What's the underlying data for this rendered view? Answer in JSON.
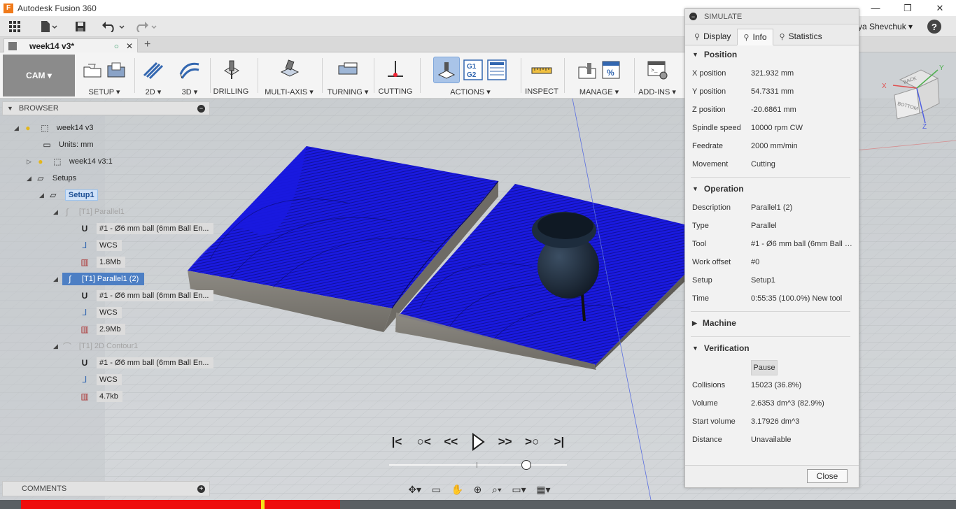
{
  "window": {
    "title": "Autodesk Fusion 360",
    "controls": [
      "—",
      "❐",
      "✕"
    ]
  },
  "qat": {
    "user": "ya Shevchuk ▾",
    "help": "?"
  },
  "document_tab": {
    "name": "week14 v3*"
  },
  "toolbar": {
    "workspace": "CAM ▾",
    "groups": [
      {
        "label": "SETUP ▾"
      },
      {
        "label": "2D ▾"
      },
      {
        "label": "3D ▾"
      },
      {
        "label": "DRILLING"
      },
      {
        "label": "MULTI-AXIS ▾"
      },
      {
        "label": "TURNING ▾"
      },
      {
        "label": "CUTTING"
      },
      {
        "label": "ACTIONS ▾"
      },
      {
        "label": "INSPECT"
      },
      {
        "label": "MANAGE ▾"
      },
      {
        "label": "ADD-INS ▾"
      }
    ],
    "actions_icon_text": "G1 G2"
  },
  "browser": {
    "title": "BROWSER",
    "nodes": [
      {
        "label": "week14 v3"
      },
      {
        "label": "Units: mm"
      },
      {
        "label": "week14 v3:1"
      },
      {
        "label": "Setups"
      },
      {
        "label": "Setup1"
      },
      {
        "label": "[T1] Parallel1"
      },
      {
        "label": "#1 - Ø6 mm ball (6mm Ball En..."
      },
      {
        "label": "WCS"
      },
      {
        "label": "1.8Mb"
      },
      {
        "label": "[T1] Parallel1 (2)"
      },
      {
        "label": "#1 - Ø6 mm ball (6mm Ball En..."
      },
      {
        "label": "WCS"
      },
      {
        "label": "2.9Mb"
      },
      {
        "label": "[T1] 2D Contour1"
      },
      {
        "label": "#1 - Ø6 mm ball (6mm Ball En..."
      },
      {
        "label": "WCS"
      },
      {
        "label": "4.7kb"
      }
    ]
  },
  "comments": {
    "title": "COMMENTS"
  },
  "simulate": {
    "title": "SIMULATE",
    "tabs": [
      "Display",
      "Info",
      "Statistics"
    ],
    "active_tab": "Info",
    "position": {
      "title": "Position",
      "rows": [
        {
          "k": "X position",
          "v": "321.932 mm"
        },
        {
          "k": "Y position",
          "v": "54.7331 mm"
        },
        {
          "k": "Z position",
          "v": "-20.6861 mm"
        },
        {
          "k": "Spindle speed",
          "v": "10000 rpm CW"
        },
        {
          "k": "Feedrate",
          "v": "2000 mm/min"
        },
        {
          "k": "Movement",
          "v": "Cutting"
        }
      ]
    },
    "operation": {
      "title": "Operation",
      "rows": [
        {
          "k": "Description",
          "v": "Parallel1 (2)"
        },
        {
          "k": "Type",
          "v": "Parallel"
        },
        {
          "k": "Tool",
          "v": "#1 - Ø6 mm ball (6mm Ball E..."
        },
        {
          "k": "Work offset",
          "v": "#0"
        },
        {
          "k": "Setup",
          "v": "Setup1"
        },
        {
          "k": "Time",
          "v": "0:55:35 (100.0%) New tool"
        }
      ]
    },
    "machine": {
      "title": "Machine"
    },
    "verification": {
      "title": "Verification",
      "pause": "Pause",
      "rows": [
        {
          "k": "Collisions",
          "v": "15023 (36.8%)"
        },
        {
          "k": "Volume",
          "v": "2.6353 dm^3 (82.9%)"
        },
        {
          "k": "Start volume",
          "v": "3.17926 dm^3"
        },
        {
          "k": "Distance",
          "v": "Unavailable"
        }
      ]
    },
    "close": "Close"
  },
  "viewcube": {
    "faces": [
      "BACK",
      "BOTTOM"
    ],
    "axes": [
      "X",
      "Y",
      "Z"
    ]
  },
  "colors": {
    "accent": "#4d7fc4",
    "toolpath": "#1414e6",
    "progress": "#ee0d0d"
  },
  "playback": {
    "position_fraction": 0.77
  }
}
